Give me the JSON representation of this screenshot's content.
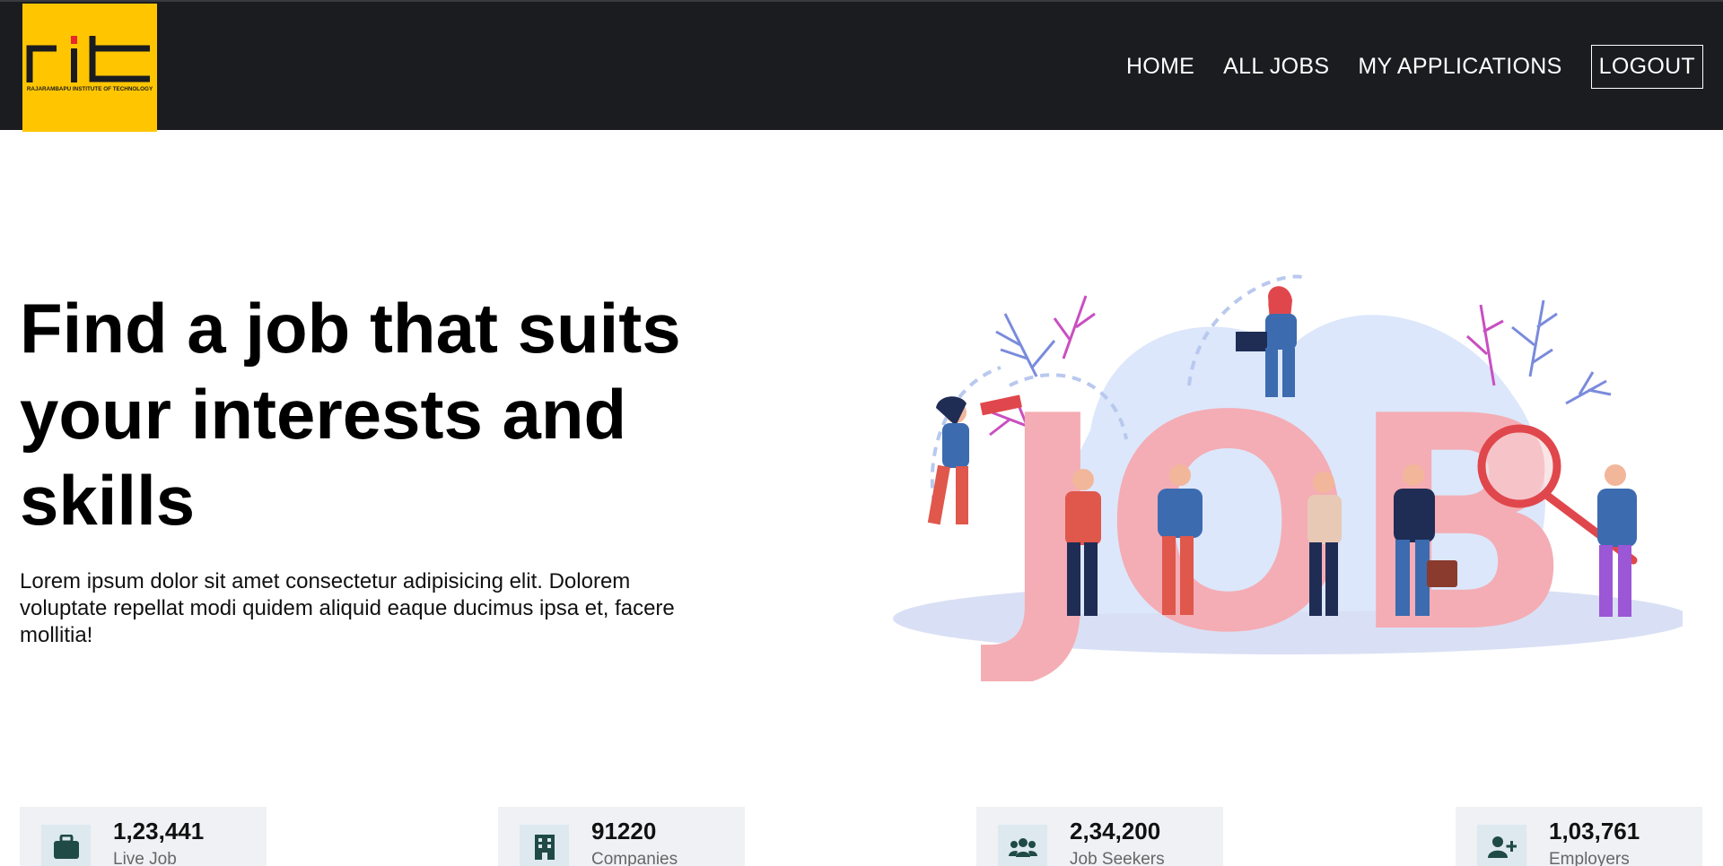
{
  "brand": {
    "logo_text": "rit",
    "logo_caption": "RAJARAMBAPU INSTITUTE OF TECHNOLOGY",
    "color": "#ffc600"
  },
  "nav": {
    "items": [
      {
        "label": "HOME"
      },
      {
        "label": "ALL JOBS"
      },
      {
        "label": "MY APPLICATIONS"
      }
    ],
    "logout_label": "LOGOUT"
  },
  "hero": {
    "title": "Find a job that suits your interests and skills",
    "description": "Lorem ipsum dolor sit amet consectetur adipisicing elit. Dolorem voluptate repellat modi quidem aliquid eaque ducimus ipsa et, facere mollitia!",
    "illustration_text": "JOB"
  },
  "stats": [
    {
      "value": "1,23,441",
      "label": "Live Job",
      "icon": "briefcase-icon"
    },
    {
      "value": "91220",
      "label": "Companies",
      "icon": "building-icon"
    },
    {
      "value": "2,34,200",
      "label": "Job Seekers",
      "icon": "users-icon"
    },
    {
      "value": "1,03,761",
      "label": "Employers",
      "icon": "user-plus-icon"
    }
  ],
  "colors": {
    "header_bg": "#1b1c1f",
    "stat_bg": "#eff1f4",
    "stat_icon_bg": "#dde9ee",
    "stat_icon_color": "#1f4a45"
  }
}
